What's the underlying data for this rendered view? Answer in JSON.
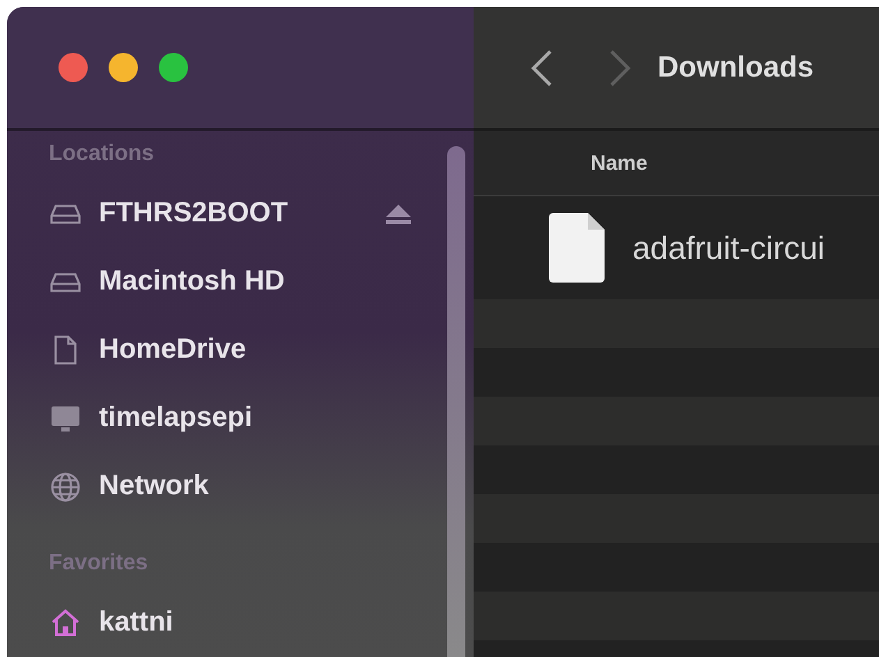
{
  "window": {
    "controls": [
      {
        "color": "#ee5a52"
      },
      {
        "color": "#f5b52e"
      },
      {
        "color": "#29c240"
      }
    ]
  },
  "sidebar": {
    "sections": [
      {
        "title": "Locations",
        "items": [
          {
            "label": "FTHRS2BOOT",
            "kind": "drive",
            "ejectable": true
          },
          {
            "label": "Macintosh HD",
            "kind": "drive",
            "ejectable": false
          },
          {
            "label": "HomeDrive",
            "kind": "document",
            "ejectable": false
          },
          {
            "label": "timelapsepi",
            "kind": "display",
            "ejectable": false
          },
          {
            "label": "Network",
            "kind": "globe",
            "ejectable": false
          }
        ]
      },
      {
        "title": "Favorites",
        "items": [
          {
            "label": "kattni",
            "kind": "home",
            "ejectable": false
          }
        ]
      }
    ]
  },
  "toolbar": {
    "back": {
      "disabled": false
    },
    "forward": {
      "disabled": true
    },
    "title": "Downloads"
  },
  "table": {
    "columns": [
      "Name"
    ],
    "rows": [
      {
        "name": "adafruit-circui"
      }
    ]
  }
}
